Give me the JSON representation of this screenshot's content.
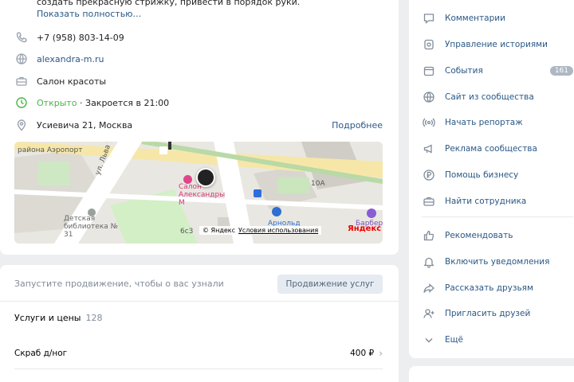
{
  "about": {
    "description_tail": "создать прекрасную стрижку, привести в порядок руки.",
    "show_more": "Показать полностью…"
  },
  "contacts": {
    "phone": "+7 (958) 803-14-09",
    "website": "alexandra-m.ru",
    "category": "Салон красоты",
    "status_open": "Открыто",
    "status_sep": " · ",
    "status_close": "Закроется в 21:00",
    "address": "Усиевича 21, Москва",
    "details_link": "Подробнее"
  },
  "map": {
    "labels": {
      "district": "района Аэропорт",
      "street": "ул. Льва Толстого",
      "salon": "Салон Александры М",
      "library": "Детская библиотека № 31",
      "bldg_10a": "10А",
      "bldg_6s3": "6с3",
      "arnold": "Арнольд",
      "barber": "Барбер"
    },
    "copyright": "© Яндекс",
    "terms": "Условия использования",
    "logo": "Яндекс"
  },
  "promo": {
    "text": "Запустите продвижение, чтобы о вас узнали",
    "button": "Продвижение услуг"
  },
  "services": {
    "title": "Услуги и цены",
    "count": "128",
    "items": [
      {
        "name": "Скраб д/ног",
        "price": "400 ₽"
      }
    ]
  },
  "menu": {
    "items": [
      {
        "label": "Комментарии",
        "icon": "comment-icon"
      },
      {
        "label": "Управление историями",
        "icon": "stories-icon"
      },
      {
        "label": "События",
        "icon": "events-icon",
        "badge": "161"
      },
      {
        "label": "Сайт из сообщества",
        "icon": "globe-icon"
      },
      {
        "label": "Начать репортаж",
        "icon": "broadcast-icon"
      },
      {
        "label": "Реклама сообщества",
        "icon": "megaphone-icon"
      },
      {
        "label": "Помощь бизнесу",
        "icon": "ruble-icon"
      },
      {
        "label": "Найти сотрудника",
        "icon": "briefcase-icon"
      }
    ],
    "actions": [
      {
        "label": "Рекомендовать",
        "icon": "thumbs-up-icon"
      },
      {
        "label": "Включить уведомления",
        "icon": "bell-icon"
      },
      {
        "label": "Рассказать друзьям",
        "icon": "share-icon"
      },
      {
        "label": "Пригласить друзей",
        "icon": "add-user-icon"
      },
      {
        "label": "Ещё",
        "icon": "chevron-down-icon"
      }
    ]
  },
  "colors": {
    "link": "#2a5885",
    "open_green": "#4bb34b",
    "background": "#edeef0"
  }
}
